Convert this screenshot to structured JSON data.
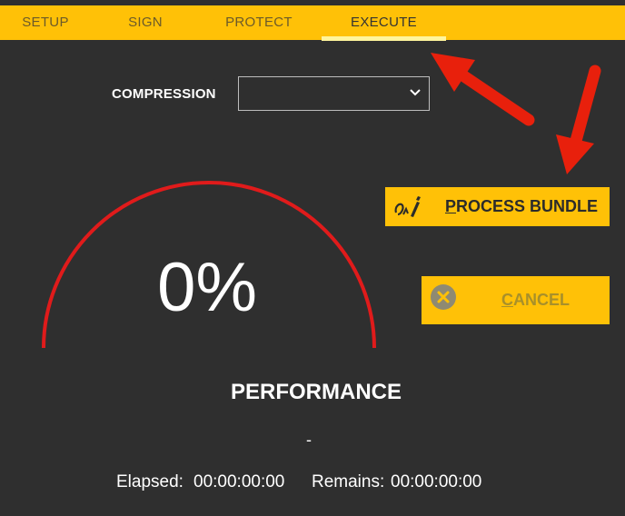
{
  "tabs": [
    {
      "label": "SETUP",
      "active": false
    },
    {
      "label": "SIGN",
      "active": false
    },
    {
      "label": "PROTECT",
      "active": false
    },
    {
      "label": "EXECUTE",
      "active": true
    }
  ],
  "compression": {
    "label": "COMPRESSION",
    "value": ""
  },
  "gauge": {
    "percent_text": "0%",
    "progress_fraction": 0.0,
    "color": "#e01b1b"
  },
  "buttons": {
    "process_bundle": {
      "label_first": "P",
      "label_rest": "ROCESS BUNDLE",
      "icon": "signature-pen-icon"
    },
    "cancel": {
      "label_first": "C",
      "label_rest": "ANCEL",
      "icon": "close-circle-icon",
      "enabled": false
    }
  },
  "status": {
    "title": "PERFORMANCE",
    "subtitle": "-",
    "elapsed_label": "Elapsed:",
    "elapsed_value": "00:00:00:00",
    "remains_label": "Remains:",
    "remains_value": "00:00:00:00"
  },
  "annotations": {
    "arrow_color": "#e8200c"
  },
  "colors": {
    "accent": "#ffc107",
    "background": "#2f2f2f"
  }
}
